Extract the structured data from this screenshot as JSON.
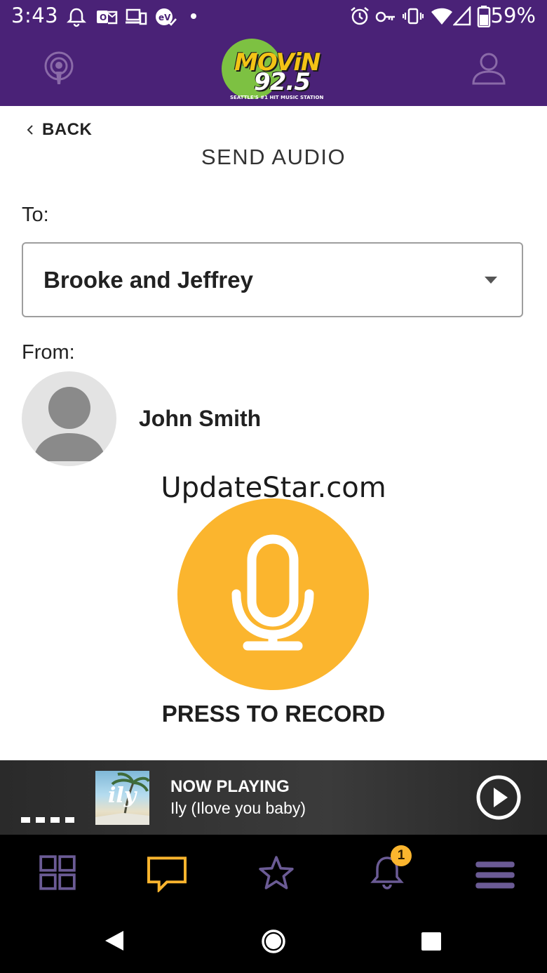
{
  "status_bar": {
    "time": "3:43",
    "battery_percent": "59%",
    "icons": [
      "bell-icon",
      "outlook-icon",
      "devices-icon",
      "ev-icon",
      "dot-icon",
      "alarm-icon",
      "key-icon",
      "vibrate-icon",
      "wifi-icon",
      "signal-icon",
      "battery-icon"
    ]
  },
  "header": {
    "logo_line1": "MOViN",
    "logo_line2": "92.5",
    "logo_tagline": "SEATTLE'S #1 HIT MUSIC STATION",
    "left_icon": "podcast-icon",
    "right_icon": "profile-icon",
    "background_color": "#4a2277"
  },
  "nav": {
    "back_label": "BACK"
  },
  "page": {
    "title": "SEND AUDIO",
    "to_label": "To:",
    "to_selected": "Brooke and Jeffrey",
    "from_label": "From:",
    "from_name": "John Smith",
    "watermark": "UpdateStar.com",
    "record_label": "PRESS TO RECORD",
    "accent_color": "#fbb52e"
  },
  "now_playing": {
    "heading": "NOW PLAYING",
    "song": "Ily (Ilove you baby)",
    "album_art_text": "ily"
  },
  "tabs": [
    {
      "name": "grid-icon"
    },
    {
      "name": "chat-icon"
    },
    {
      "name": "star-icon"
    },
    {
      "name": "bell-icon",
      "badge": "1"
    },
    {
      "name": "menu-icon"
    }
  ]
}
